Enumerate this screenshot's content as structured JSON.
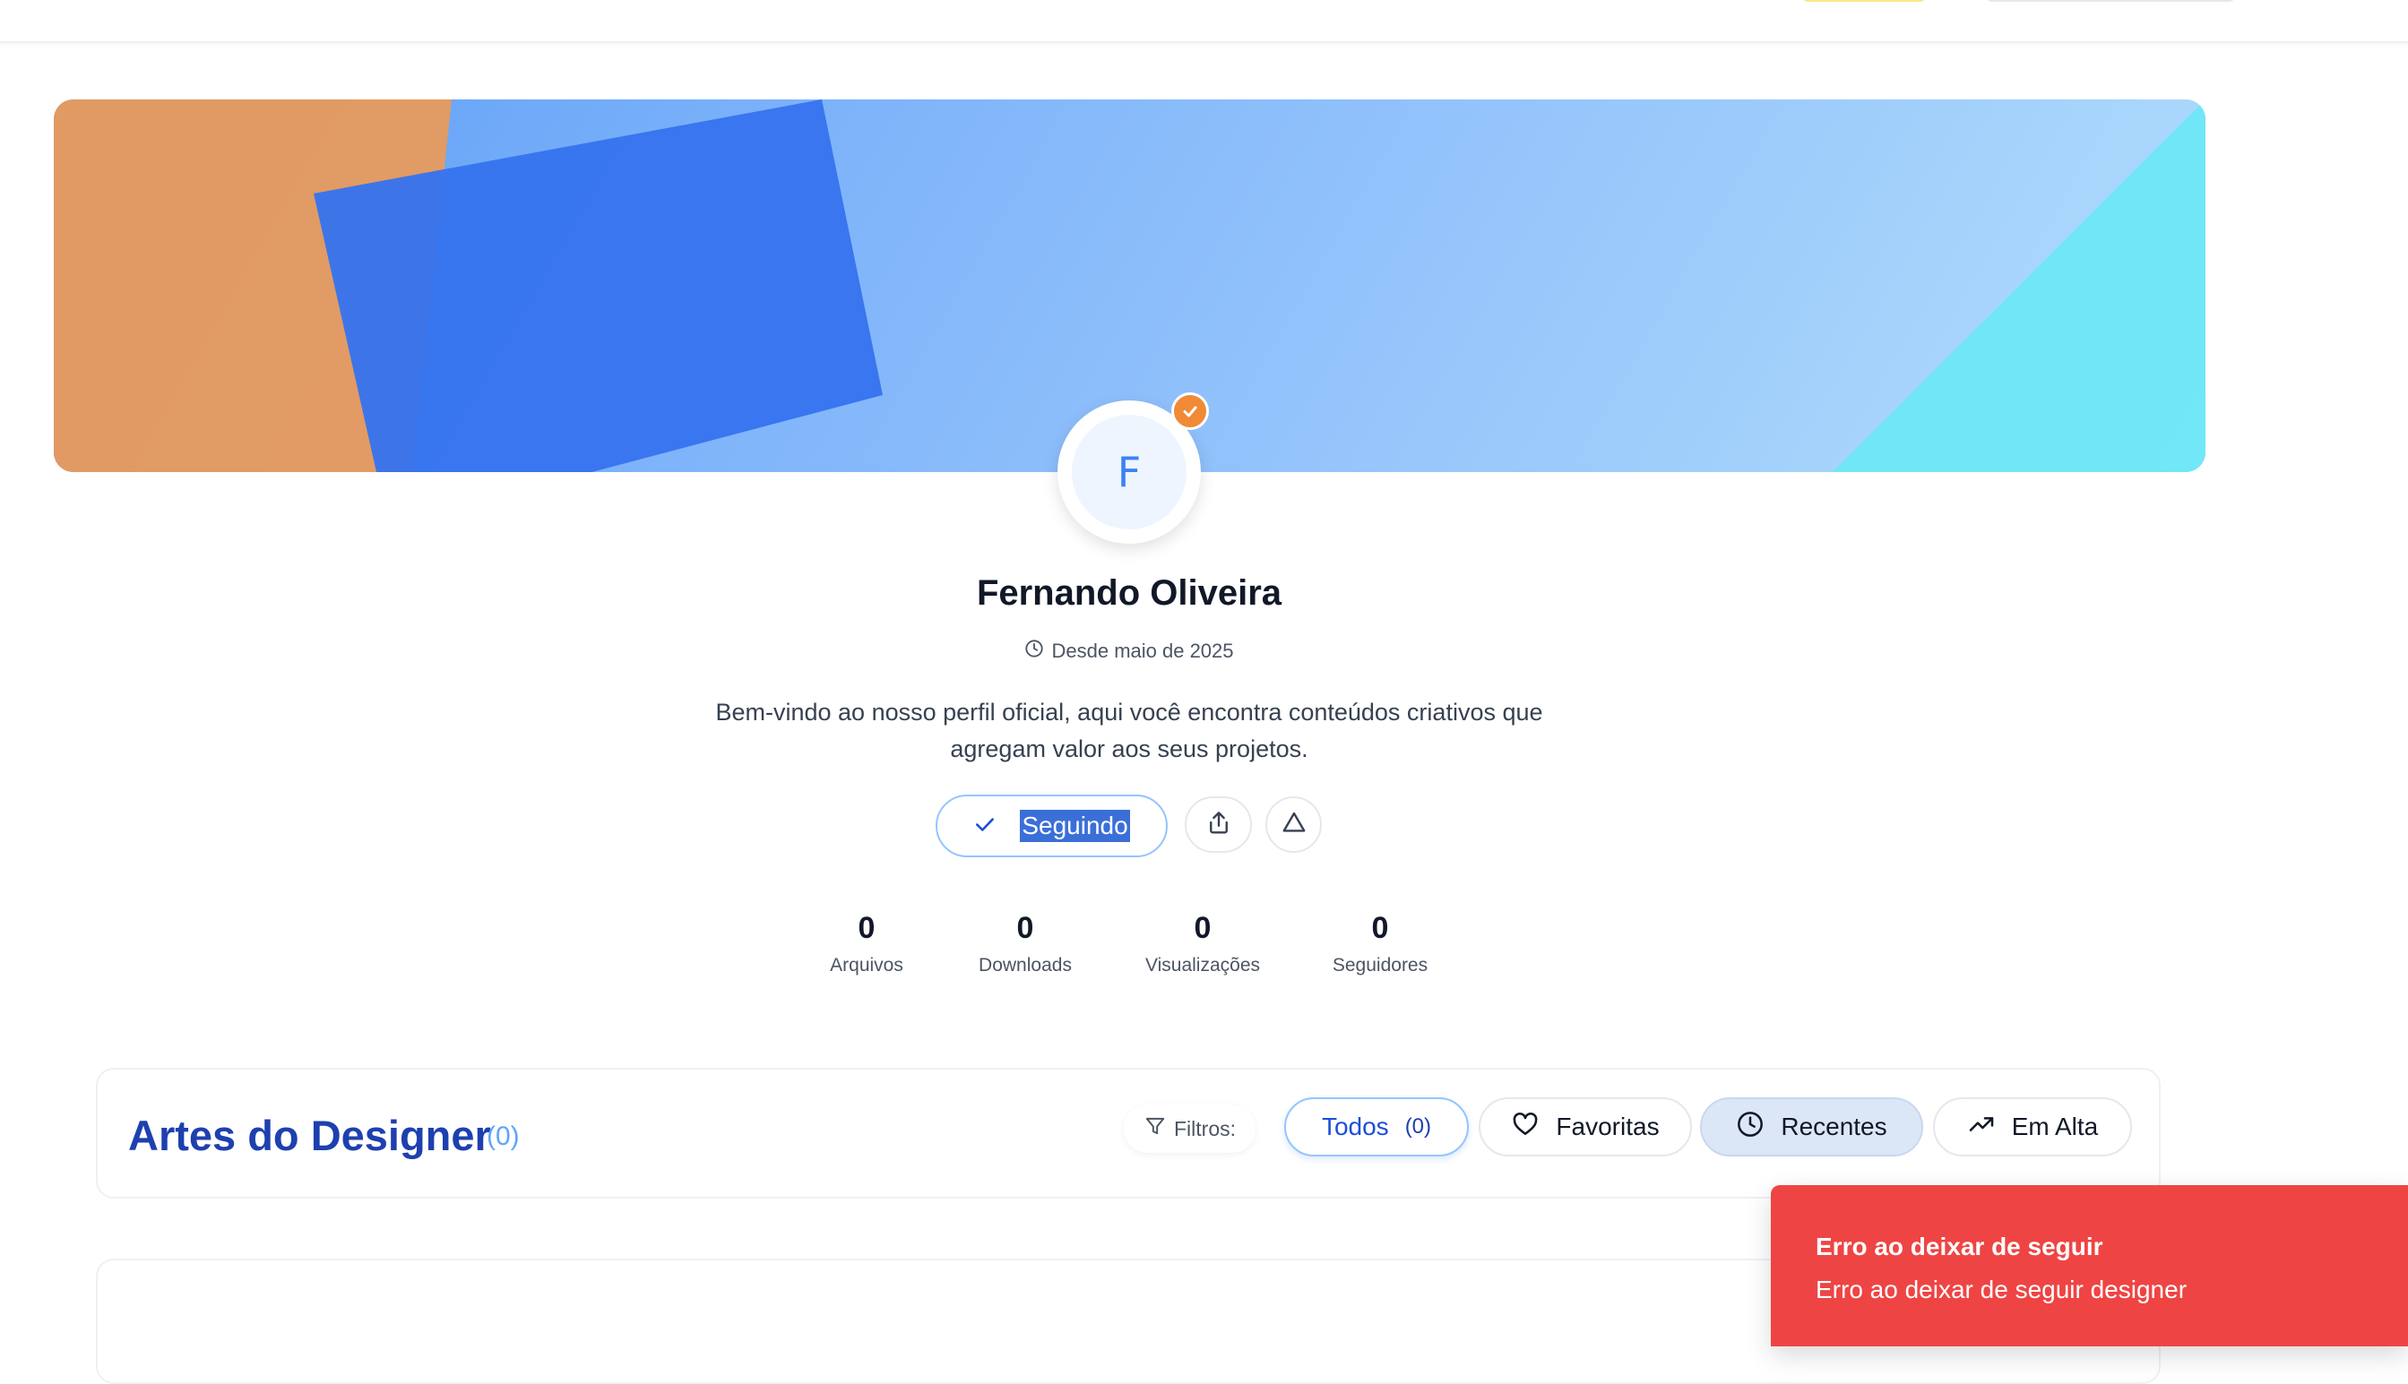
{
  "profile": {
    "avatar_initial": "F",
    "name": "Fernando Oliveira",
    "since": "Desde maio de 2025",
    "bio": "Bem-vindo ao nosso perfil oficial, aqui você encontra conteúdos criativos que agregam valor aos seus projetos.",
    "follow_label": "Seguindo"
  },
  "stats": [
    {
      "value": "0",
      "label": "Arquivos"
    },
    {
      "value": "0",
      "label": "Downloads"
    },
    {
      "value": "0",
      "label": "Visualizações"
    },
    {
      "value": "0",
      "label": "Seguidores"
    }
  ],
  "section": {
    "title": "Artes do Designer",
    "count": "(0)",
    "filters_label": "Filtros:",
    "chips": {
      "todos": "Todos",
      "todos_count": "(0)",
      "favoritas": "Favoritas",
      "recentes": "Recentes",
      "em_alta": "Em Alta"
    }
  },
  "toast": {
    "title": "Erro ao deixar de seguir",
    "description": "Erro ao deixar de seguir designer"
  },
  "icons": {
    "verified": "check-badge-icon",
    "since": "clock-icon",
    "follow": "check-icon",
    "share": "share-icon",
    "report": "warning-triangle-icon",
    "filter": "filter-icon",
    "favoritas": "heart-icon",
    "recentes": "clock-icon",
    "em_alta": "trending-up-icon"
  },
  "colors": {
    "accent": "#3b82f6",
    "title_blue": "#1e40af",
    "verified_badge": "#f08a35",
    "toast_bg": "#ef4444"
  }
}
